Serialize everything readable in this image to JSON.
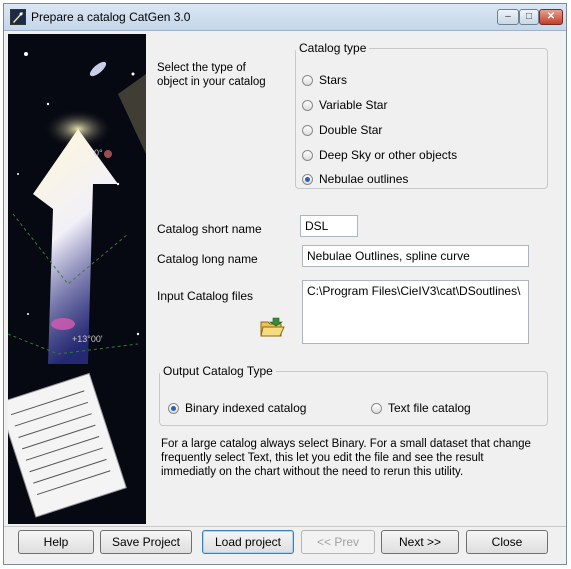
{
  "window": {
    "title": "Prepare a catalog CatGen 3.0",
    "controls": {
      "minimize": "–",
      "maximize": "□",
      "close": "✕"
    }
  },
  "side_art": {
    "labels": [
      "0°",
      "+13°00'"
    ]
  },
  "object_prompt": "Select the type of object in your catalog",
  "catalog_type": {
    "legend": "Catalog type",
    "options": [
      {
        "label": "Stars",
        "selected": false
      },
      {
        "label": "Variable Star",
        "selected": false
      },
      {
        "label": "Double Star",
        "selected": false
      },
      {
        "label": "Deep Sky or other objects",
        "selected": false
      },
      {
        "label": "Nebulae outlines",
        "selected": true
      }
    ]
  },
  "fields": {
    "short_name_label": "Catalog short name",
    "short_name_value": "DSL",
    "long_name_label": "Catalog long name",
    "long_name_value": "Nebulae Outlines, spline curve",
    "input_files_label": "Input Catalog files",
    "input_files_value": "C:\\Program Files\\CieIV3\\cat\\DSoutlines\\"
  },
  "output_type": {
    "legend": "Output Catalog Type",
    "options": [
      {
        "label": "Binary indexed catalog",
        "selected": true
      },
      {
        "label": "Text file catalog",
        "selected": false
      }
    ]
  },
  "info_text": "For a large catalog always select Binary. For a small dataset that change frequently select Text, this let you edit the file and see the result immediatly on the chart without the need to rerun this utility.",
  "buttons": {
    "help": "Help",
    "save_project": "Save Project",
    "load_project": "Load project",
    "prev": "<< Prev",
    "next": "Next  >>",
    "close": "Close"
  },
  "icons": {
    "app": "catgen-app-icon",
    "folder": "open-folder-icon"
  },
  "colors": {
    "title_bar": "#c4d6ea",
    "radio_selected": "#2a62b8",
    "close_button": "#c0402a"
  }
}
